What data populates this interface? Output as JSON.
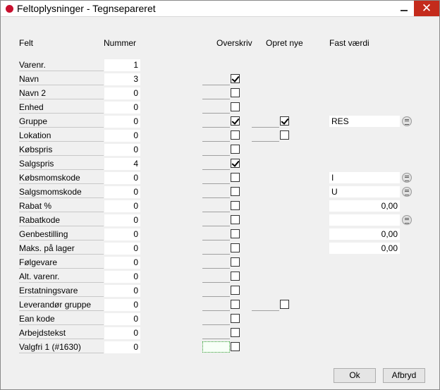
{
  "window": {
    "title": "Feltoplysninger - Tegnsepareret",
    "close_glyph": "✕"
  },
  "headers": {
    "felt": "Felt",
    "nummer": "Nummer",
    "overskriv": "Overskriv",
    "opret_nye": "Opret nye",
    "fast_vaerdi": "Fast værdi"
  },
  "rows": [
    {
      "label": "Varenr.",
      "number": "1"
    },
    {
      "label": "Navn",
      "number": "3",
      "overwrite": true
    },
    {
      "label": "Navn 2",
      "number": "0",
      "overwrite": false
    },
    {
      "label": "Enhed",
      "number": "0",
      "overwrite": false
    },
    {
      "label": "Gruppe",
      "number": "0",
      "overwrite": true,
      "create_new": true,
      "fixed_value": "RES",
      "lookup": true
    },
    {
      "label": "Lokation",
      "number": "0",
      "overwrite": false,
      "create_new": false
    },
    {
      "label": "Købspris",
      "number": "0",
      "overwrite": false
    },
    {
      "label": "Salgspris",
      "number": "4",
      "overwrite": true
    },
    {
      "label": "Købsmomskode",
      "number": "0",
      "overwrite": false,
      "fixed_value": "I",
      "lookup": true
    },
    {
      "label": "Salgsmomskode",
      "number": "0",
      "overwrite": false,
      "fixed_value": "U",
      "lookup": true
    },
    {
      "label": "Rabat %",
      "number": "0",
      "overwrite": false,
      "fixed_value": "0,00"
    },
    {
      "label": "Rabatkode",
      "number": "0",
      "overwrite": false,
      "fixed_value": "",
      "lookup": true
    },
    {
      "label": "Genbestilling",
      "number": "0",
      "overwrite": false,
      "fixed_value": "0,00"
    },
    {
      "label": "Maks. på lager",
      "number": "0",
      "overwrite": false,
      "fixed_value": "0,00"
    },
    {
      "label": "Følgevare",
      "number": "0",
      "overwrite": false
    },
    {
      "label": "Alt. varenr.",
      "number": "0",
      "overwrite": false
    },
    {
      "label": "Erstatningsvare",
      "number": "0",
      "overwrite": false
    },
    {
      "label": "Leverandør gruppe",
      "number": "0",
      "overwrite": false,
      "create_new": false
    },
    {
      "label": "Ean kode",
      "number": "0",
      "overwrite": false
    },
    {
      "label": "Arbejdstekst",
      "number": "0",
      "overwrite": false
    },
    {
      "label": "Valgfri 1 (#1630)",
      "number": "0",
      "overwrite": false,
      "focused": true
    }
  ],
  "buttons": {
    "ok": "Ok",
    "cancel": "Afbryd"
  }
}
